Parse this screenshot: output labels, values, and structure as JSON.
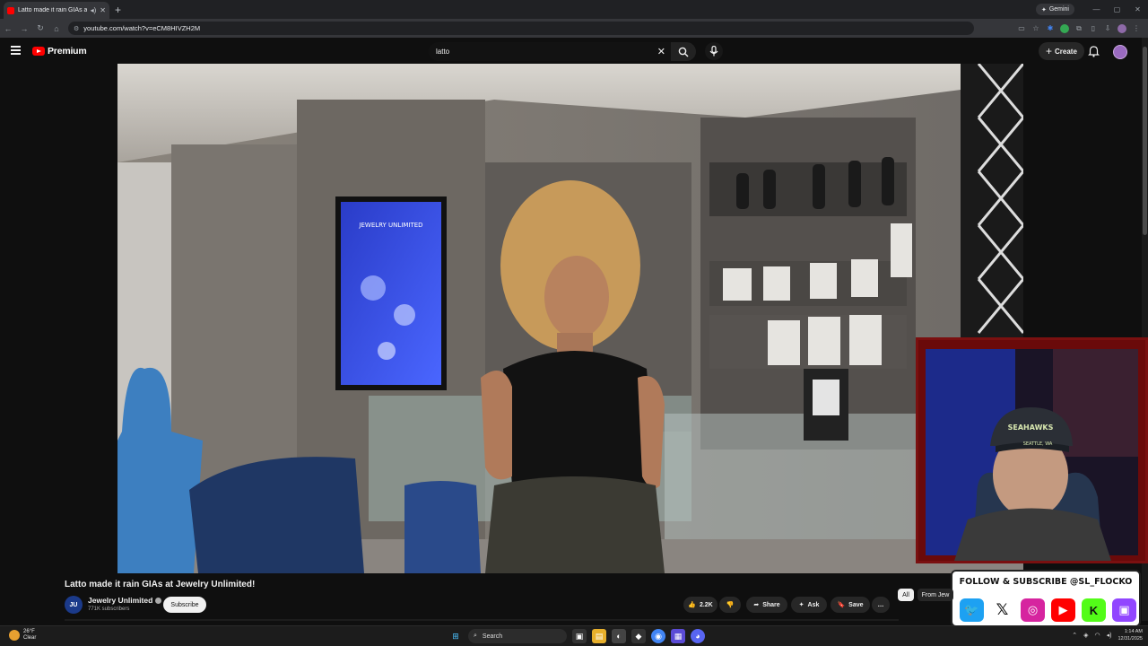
{
  "browser": {
    "tab_title": "Latto made it rain GIAs at J",
    "new_tab": "+",
    "gemini_label": "Gemini",
    "url": "youtube.com/watch?v=eCM8HIVZH2M"
  },
  "youtube": {
    "logo_text": "Premium",
    "search_value": "latto",
    "create_label": "Create"
  },
  "video": {
    "title": "Latto made it rain GIAs at Jewelry Unlimited!",
    "channel": "Jewelry Unlimited",
    "subscribers": "771K subscribers",
    "subscribe_label": "Subscribe",
    "likes": "2.2K",
    "share_label": "Share",
    "ask_label": "Ask",
    "save_label": "Save",
    "more_label": "…",
    "chips": [
      "All",
      "From Jew"
    ]
  },
  "overlay": {
    "follow_text": "FOLLOW & SUBSCRIBE @SL_FLOCKO",
    "hat_text_1": "SEAHAWKS",
    "hat_text_2": "SEATTLE, WA",
    "screen_text": "JEWELRY UNLIMITED"
  },
  "taskbar": {
    "temp": "26°F",
    "condition": "Clear",
    "search_label": "Search",
    "time": "1:14 AM",
    "date": "12/31/2025"
  },
  "colors": {
    "youtube_red": "#ff0000",
    "overlay_border": "#7a1010"
  }
}
